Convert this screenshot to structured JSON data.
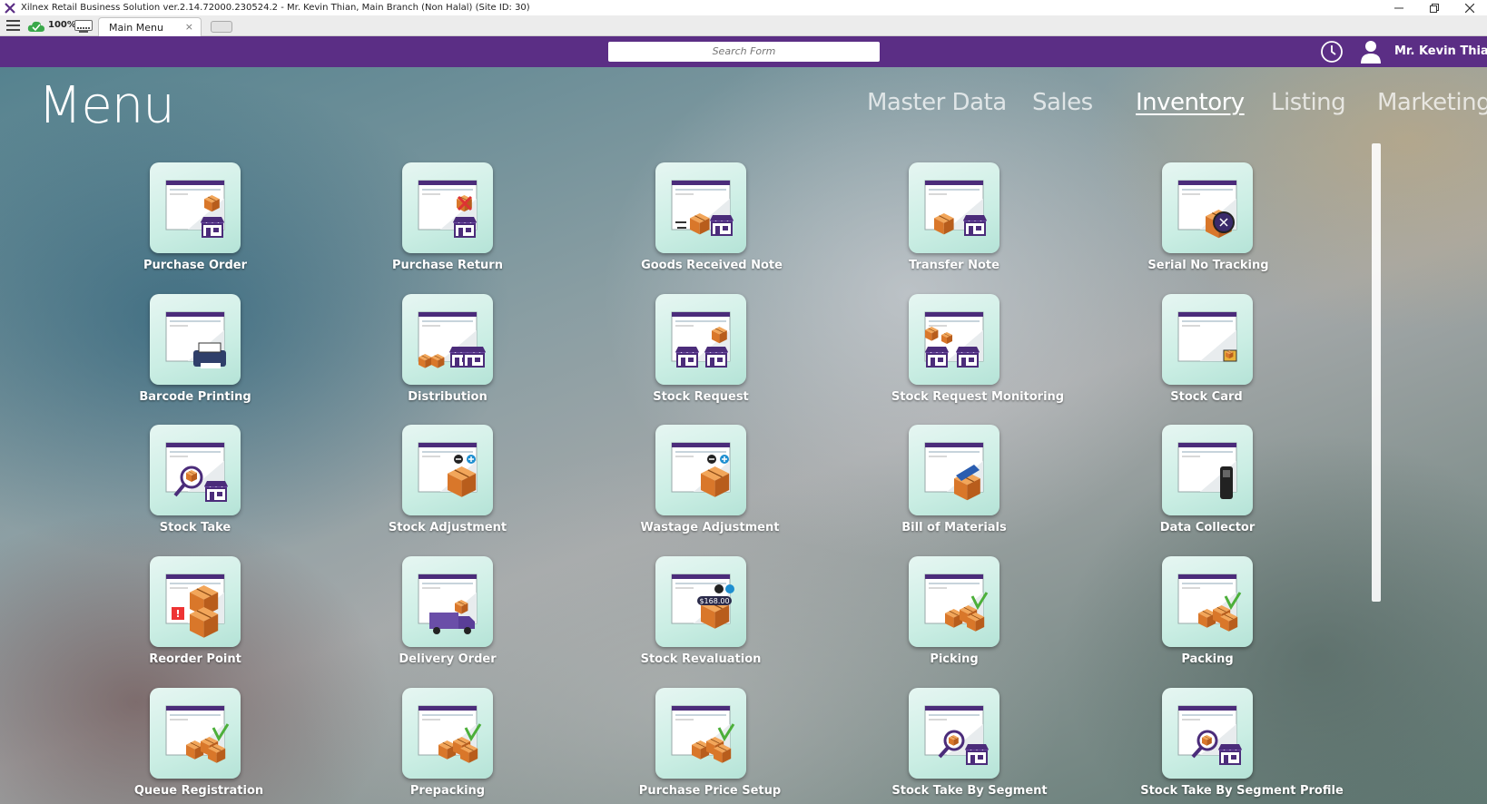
{
  "window": {
    "title": "Xilnex Retail Business Solution ver.2.14.72000.230524.2 - Mr. Kevin Thian, Main Branch (Non Halal) (Site ID: 30)",
    "minimize_icon": "minimize-icon",
    "restore_icon": "restore-icon",
    "close_icon": "close-icon"
  },
  "toolbar": {
    "zoom": "100%",
    "tab_label": "Main Menu",
    "tab_close": "×"
  },
  "header": {
    "search_placeholder": "Search Form",
    "username": "Mr. Kevin Thian",
    "accent_color": "#5b2e85"
  },
  "menu": {
    "title": "Menu",
    "nav_tabs": [
      {
        "label": "Master Data",
        "active": false
      },
      {
        "label": "Sales",
        "active": false
      },
      {
        "label": "Inventory",
        "active": true
      },
      {
        "label": "Listing",
        "active": false
      },
      {
        "label": "Marketing",
        "active": false
      }
    ],
    "items": [
      {
        "label": "Purchase Order",
        "icon": "purchase-order-icon"
      },
      {
        "label": "Purchase Return",
        "icon": "purchase-return-icon"
      },
      {
        "label": "Goods Received Note",
        "icon": "goods-received-note-icon"
      },
      {
        "label": "Transfer Note",
        "icon": "transfer-note-icon"
      },
      {
        "label": "Serial No Tracking",
        "icon": "serial-no-tracking-icon"
      },
      {
        "label": "Barcode Printing",
        "icon": "barcode-printing-icon"
      },
      {
        "label": "Distribution",
        "icon": "distribution-icon"
      },
      {
        "label": "Stock Request",
        "icon": "stock-request-icon"
      },
      {
        "label": "Stock Request Monitoring",
        "icon": "stock-request-monitoring-icon"
      },
      {
        "label": "Stock Card",
        "icon": "stock-card-icon"
      },
      {
        "label": "Stock Take",
        "icon": "stock-take-icon"
      },
      {
        "label": "Stock Adjustment",
        "icon": "stock-adjustment-icon"
      },
      {
        "label": "Wastage Adjustment",
        "icon": "wastage-adjustment-icon"
      },
      {
        "label": "Bill of Materials",
        "icon": "bill-of-materials-icon"
      },
      {
        "label": "Data Collector",
        "icon": "data-collector-icon"
      },
      {
        "label": "Reorder Point",
        "icon": "reorder-point-icon"
      },
      {
        "label": "Delivery Order",
        "icon": "delivery-order-icon"
      },
      {
        "label": "Stock Revaluation",
        "icon": "stock-revaluation-icon",
        "badge": "$168.00"
      },
      {
        "label": "Picking",
        "icon": "picking-icon"
      },
      {
        "label": "Packing",
        "icon": "packing-icon"
      },
      {
        "label": "Queue Registration",
        "icon": "queue-registration-icon"
      },
      {
        "label": "Prepacking",
        "icon": "prepacking-icon"
      },
      {
        "label": "Purchase Price Setup",
        "icon": "purchase-price-setup-icon"
      },
      {
        "label": "Stock Take By Segment",
        "icon": "stock-take-by-segment-icon"
      },
      {
        "label": "Stock Take By Segment Profile",
        "icon": "stock-take-by-segment-profile-icon"
      }
    ]
  }
}
